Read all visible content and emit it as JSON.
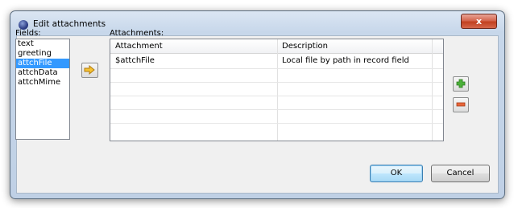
{
  "window": {
    "title": "Edit attachments",
    "close_glyph": "x"
  },
  "fields": {
    "label": "Fields:",
    "items": [
      "text",
      "greeting",
      "attchFile",
      "attchData",
      "attchMime"
    ],
    "selected_index": 2
  },
  "attachments": {
    "label": "Attachments:",
    "columns": [
      "Attachment",
      "Description"
    ],
    "rows": [
      {
        "attachment": "$attchFile",
        "description": "Local file by path in record field"
      }
    ]
  },
  "icons": {
    "add_to_attachments": "arrow-right-icon",
    "add": "plus-icon",
    "remove": "minus-icon"
  },
  "buttons": {
    "ok": "OK",
    "cancel": "Cancel"
  },
  "colors": {
    "selection": "#3399ff",
    "close_button": "#c2401f",
    "add_icon": "#3a9b2a",
    "remove_icon": "#d9552a",
    "arrow_icon": "#f0b020"
  }
}
